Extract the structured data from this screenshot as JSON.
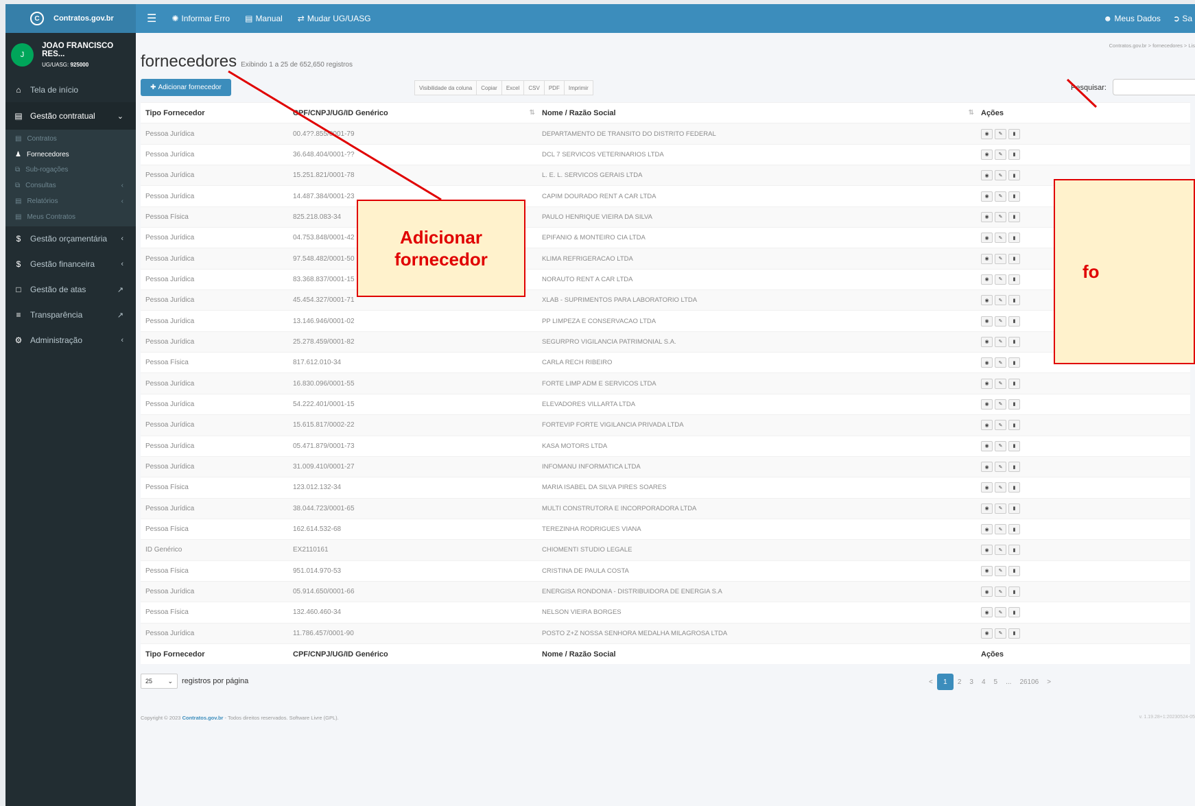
{
  "topbar": {
    "brand": "Contratos.gov.br",
    "informar_erro": "Informar Erro",
    "manual": "Manual",
    "mudar_ug": "Mudar UG/UASG",
    "meus_dados": "Meus Dados",
    "sair": "Sa"
  },
  "user": {
    "initial": "J",
    "name": "JOAO FRANCISCO RES...",
    "ug_label": "UG/UASG:",
    "ug_value": "925000"
  },
  "sidebar": {
    "tela_inicio": "Tela de início",
    "gestao_contratual": "Gestão contratual",
    "sub": [
      "Contratos",
      "Fornecedores",
      "Sub-rogações",
      "Consultas",
      "Relatórios",
      "Meus Contratos"
    ],
    "gestao_orcamentaria": "Gestão orçamentária",
    "gestao_financeira": "Gestão financeira",
    "gestao_atas": "Gestão de atas",
    "transparencia": "Transparência",
    "administracao": "Administração"
  },
  "page": {
    "title": "fornecedores",
    "subtitle": "Exibindo 1 a 25 de 652,650 registros",
    "breadcrumb": "Contratos.gov.br  >  fornecedores  >  Lis",
    "add_button": "Adicionar fornecedor",
    "export_buttons": [
      "Visibilidade da coluna",
      "Copiar",
      "Excel",
      "CSV",
      "PDF",
      "Imprimir"
    ],
    "search_label": "Pesquisar:",
    "search_value": ""
  },
  "table": {
    "headers": [
      "Tipo Fornecedor",
      "CPF/CNPJ/UG/ID Genérico",
      "Nome / Razão Social",
      "Ações"
    ],
    "rows": [
      [
        "Pessoa Jurídica",
        "00.4??.855/0001-79",
        "DEPARTAMENTO DE TRANSITO DO DISTRITO FEDERAL"
      ],
      [
        "Pessoa Jurídica",
        "36.648.404/0001-??",
        "DCL 7 SERVICOS VETERINARIOS LTDA"
      ],
      [
        "Pessoa Jurídica",
        "15.251.821/0001-78",
        "L. E. L. SERVICOS GERAIS LTDA"
      ],
      [
        "Pessoa Jurídica",
        "14.487.384/0001-23",
        "CAPIM DOURADO RENT A CAR LTDA"
      ],
      [
        "Pessoa Física",
        "825.218.083-34",
        "PAULO HENRIQUE VIEIRA DA SILVA"
      ],
      [
        "Pessoa Jurídica",
        "04.753.848/0001-42",
        "EPIFANIO & MONTEIRO CIA LTDA"
      ],
      [
        "Pessoa Jurídica",
        "97.548.482/0001-50",
        "KLIMA REFRIGERACAO LTDA"
      ],
      [
        "Pessoa Jurídica",
        "83.368.837/0001-15",
        "NORAUTO RENT A CAR LTDA"
      ],
      [
        "Pessoa Jurídica",
        "45.454.327/0001-71",
        "XLAB - SUPRIMENTOS PARA LABORATORIO LTDA"
      ],
      [
        "Pessoa Jurídica",
        "13.146.946/0001-02",
        "PP LIMPEZA E CONSERVACAO LTDA"
      ],
      [
        "Pessoa Jurídica",
        "25.278.459/0001-82",
        "SEGURPRO VIGILANCIA PATRIMONIAL S.A."
      ],
      [
        "Pessoa Física",
        "817.612.010-34",
        "CARLA RECH RIBEIRO"
      ],
      [
        "Pessoa Jurídica",
        "16.830.096/0001-55",
        "FORTE LIMP ADM E SERVICOS LTDA"
      ],
      [
        "Pessoa Jurídica",
        "54.222.401/0001-15",
        "ELEVADORES VILLARTA LTDA"
      ],
      [
        "Pessoa Jurídica",
        "15.615.817/0002-22",
        "FORTEVIP FORTE VIGILANCIA PRIVADA LTDA"
      ],
      [
        "Pessoa Jurídica",
        "05.471.879/0001-73",
        "KASA MOTORS LTDA"
      ],
      [
        "Pessoa Jurídica",
        "31.009.410/0001-27",
        "INFOMANU INFORMATICA LTDA"
      ],
      [
        "Pessoa Física",
        "123.012.132-34",
        "MARIA ISABEL DA SILVA PIRES SOARES"
      ],
      [
        "Pessoa Jurídica",
        "38.044.723/0001-65",
        "MULTI CONSTRUTORA E INCORPORADORA LTDA"
      ],
      [
        "Pessoa Física",
        "162.614.532-68",
        "TEREZINHA RODRIGUES VIANA"
      ],
      [
        "ID Genérico",
        "EX2110161",
        "CHIOMENTI STUDIO LEGALE"
      ],
      [
        "Pessoa Física",
        "951.014.970-53",
        "CRISTINA DE PAULA COSTA"
      ],
      [
        "Pessoa Jurídica",
        "05.914.650/0001-66",
        "ENERGISA RONDONIA - DISTRIBUIDORA DE ENERGIA S.A"
      ],
      [
        "Pessoa Física",
        "132.460.460-34",
        "NELSON VIEIRA BORGES"
      ],
      [
        "Pessoa Jurídica",
        "11.786.457/0001-90",
        "POSTO Z+Z NOSSA SENHORA MEDALHA MILAGROSA LTDA"
      ]
    ]
  },
  "pagination": {
    "per_page_value": "25",
    "per_page_label": "registros por página",
    "prev": "<",
    "pages": [
      "1",
      "2",
      "3",
      "4",
      "5",
      "...",
      "26106"
    ],
    "next": ">"
  },
  "footer": {
    "prefix": "Copyright © 2023",
    "brand": "Contratos.gov.br",
    "suffix": "- Todos direitos reservados. Software Livre (GPL).",
    "version": "v. 1.19.28+1:20230524-05"
  },
  "callouts": {
    "add_supplier": "Adicionar fornecedor",
    "right_fragment": "fo"
  },
  "colors": {
    "primary": "#3c8dbc",
    "sidebar": "#222d32",
    "callout_border": "#e00000",
    "callout_fill": "#fff2cc"
  }
}
